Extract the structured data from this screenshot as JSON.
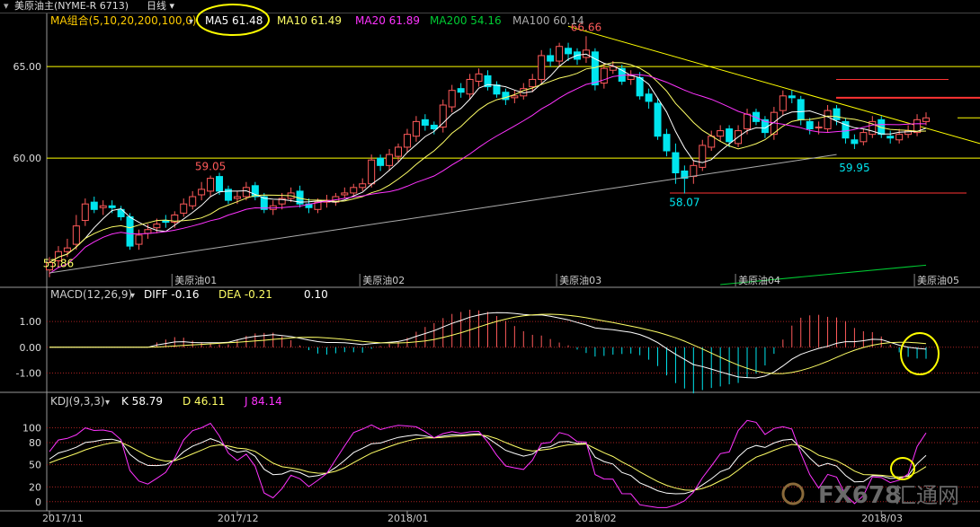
{
  "header": {
    "instrument": "美原油主(NYME-R 6713)",
    "period": "日线"
  },
  "colors": {
    "up": "#ff5a5a",
    "down": "#00e5ee",
    "ma5": "#ffffff",
    "ma10": "#ffff66",
    "ma20": "#ff33ff",
    "ma200": "#00cc33",
    "ma100": "#aaaaaa",
    "trend": "#ffff00",
    "hline_yellow": "#ffff00",
    "hline_red": "#ff3333",
    "grid": "#aa2222"
  },
  "chart_data": [
    {
      "type": "candlestick",
      "indicator_label": "MA组合(5,10,20,200,100,0)",
      "ma_legend": [
        {
          "name": "MA5",
          "value": "61.48"
        },
        {
          "name": "MA10",
          "value": "61.49"
        },
        {
          "name": "MA20",
          "value": "61.89"
        },
        {
          "name": "MA200",
          "value": "54.16"
        },
        {
          "name": "MA100",
          "value": "60.14"
        }
      ],
      "y_ticks": [
        "65.00",
        "60.00"
      ],
      "ylim": [
        53.0,
        67.9
      ],
      "annotations": [
        {
          "text": "66.66",
          "bar": 60,
          "value": 66.66
        },
        {
          "text": "59.05",
          "bar": 18,
          "value": 59.05
        },
        {
          "text": "58.07",
          "bar": 71,
          "value": 58.07
        },
        {
          "text": "59.95",
          "bar": 90,
          "value": 59.95
        },
        {
          "text": "53.86",
          "bar": 1,
          "value": 53.86
        }
      ],
      "contract_labels": [
        {
          "text": "美原油01",
          "bar": 14
        },
        {
          "text": "美原油02",
          "bar": 35
        },
        {
          "text": "美原油03",
          "bar": 57
        },
        {
          "text": "美原油04",
          "bar": 77
        },
        {
          "text": "美原油05",
          "bar": 97
        }
      ],
      "closes": [
        54.3,
        54.9,
        55.1,
        56.3,
        57.5,
        57.2,
        57.4,
        57.3,
        56.8,
        55.2,
        55.8,
        56.1,
        56.4,
        56.5,
        56.9,
        57.5,
        57.9,
        58.3,
        58.9,
        58.2,
        57.7,
        57.9,
        58.4,
        57.9,
        57.2,
        57.4,
        57.8,
        58.1,
        57.5,
        57.3,
        57.6,
        57.7,
        57.9,
        58.1,
        58.4,
        58.6,
        59.9,
        59.6,
        60.2,
        60.6,
        61.3,
        62.0,
        61.8,
        61.6,
        62.9,
        63.7,
        63.6,
        64.3,
        64.6,
        63.9,
        63.5,
        63.2,
        63.4,
        63.8,
        64.3,
        65.6,
        65.3,
        66.1,
        65.7,
        65.4,
        65.9,
        64.0,
        64.9,
        65.0,
        64.2,
        64.5,
        63.4,
        63.1,
        61.2,
        60.4,
        59.2,
        58.9,
        59.6,
        60.7,
        61.2,
        61.5,
        60.9,
        61.5,
        62.4,
        62.0,
        61.4,
        62.5,
        63.4,
        63.3,
        62.1,
        61.6,
        61.7,
        62.6,
        62.1,
        61.1,
        60.8,
        61.4,
        62.0,
        61.3,
        61.1,
        61.3,
        61.5,
        62.1,
        62.2
      ],
      "opens": [
        53.9,
        54.4,
        54.9,
        55.3,
        56.6,
        57.6,
        57.3,
        57.4,
        57.2,
        56.8,
        55.3,
        55.9,
        56.2,
        56.6,
        56.5,
        57.0,
        57.4,
        58.0,
        58.2,
        59.0,
        58.3,
        57.8,
        57.9,
        58.5,
        57.9,
        57.2,
        57.5,
        57.8,
        58.2,
        57.5,
        57.2,
        57.6,
        57.6,
        58.0,
        58.1,
        58.4,
        58.6,
        60.0,
        59.6,
        60.1,
        60.6,
        61.2,
        62.1,
        61.8,
        61.7,
        62.8,
        63.8,
        63.5,
        64.2,
        64.5,
        64.0,
        63.6,
        63.3,
        63.4,
        63.9,
        64.3,
        65.6,
        65.3,
        66.0,
        65.8,
        65.5,
        65.8,
        64.1,
        64.8,
        64.9,
        64.3,
        64.4,
        63.5,
        63.0,
        61.3,
        60.3,
        59.3,
        59.0,
        59.5,
        60.6,
        61.2,
        61.6,
        60.8,
        61.6,
        62.5,
        62.1,
        61.3,
        62.6,
        63.4,
        63.2,
        62.0,
        61.7,
        61.6,
        62.7,
        62.0,
        61.0,
        60.9,
        61.3,
        62.1,
        61.2,
        61.0,
        61.3,
        61.4,
        62.0
      ],
      "highs": [
        54.6,
        55.2,
        55.6,
        56.9,
        57.8,
        57.9,
        57.7,
        57.7,
        57.4,
        57.0,
        56.1,
        56.4,
        56.7,
        56.9,
        57.1,
        57.8,
        58.2,
        58.7,
        59.05,
        59.2,
        58.5,
        58.2,
        58.7,
        58.7,
        58.1,
        57.7,
        58.1,
        58.4,
        58.5,
        57.8,
        57.8,
        58.0,
        58.1,
        58.4,
        58.6,
        58.9,
        60.2,
        60.2,
        60.5,
        60.8,
        61.6,
        62.3,
        62.4,
        62.0,
        63.2,
        64.0,
        64.1,
        64.6,
        64.9,
        64.8,
        64.2,
        63.8,
        63.7,
        64.1,
        64.6,
        65.9,
        66.0,
        66.3,
        66.3,
        66.0,
        66.66,
        66.0,
        65.2,
        65.3,
        65.1,
        64.8,
        64.7,
        63.8,
        63.3,
        61.6,
        60.8,
        59.6,
        59.9,
        61.0,
        61.5,
        61.8,
        61.8,
        61.8,
        62.7,
        62.7,
        62.3,
        62.8,
        63.7,
        63.7,
        63.4,
        62.2,
        62.0,
        62.9,
        62.9,
        62.2,
        61.3,
        61.6,
        62.3,
        62.3,
        61.5,
        61.6,
        61.8,
        62.4,
        62.5
      ],
      "lows": [
        53.5,
        54.1,
        54.6,
        55.0,
        56.3,
        57.0,
        56.9,
        57.0,
        56.6,
        55.0,
        55.0,
        55.6,
        55.9,
        56.2,
        56.2,
        56.8,
        57.2,
        57.7,
        57.9,
        58.0,
        57.5,
        57.5,
        57.7,
        57.7,
        57.0,
        56.9,
        57.2,
        57.6,
        57.3,
        57.0,
        57.0,
        57.3,
        57.4,
        57.8,
        57.9,
        58.2,
        58.4,
        59.3,
        59.3,
        59.8,
        60.3,
        60.9,
        61.5,
        61.3,
        61.4,
        62.5,
        63.3,
        63.2,
        63.9,
        63.7,
        63.3,
        62.9,
        63.0,
        63.2,
        63.6,
        64.1,
        65.0,
        65.0,
        65.3,
        65.1,
        65.2,
        63.7,
        63.8,
        64.6,
        64.0,
        64.0,
        63.2,
        62.7,
        61.0,
        60.1,
        58.6,
        58.07,
        58.6,
        59.3,
        60.4,
        60.9,
        60.6,
        60.6,
        61.3,
        61.8,
        61.1,
        61.0,
        62.3,
        63.0,
        61.8,
        61.3,
        61.3,
        61.4,
        61.8,
        60.8,
        60.5,
        60.7,
        61.1,
        61.1,
        60.8,
        60.8,
        61.1,
        61.2,
        61.8
      ]
    },
    {
      "type": "line",
      "indicator_label": "MACD(12,26,9)",
      "legend": [
        {
          "name": "DIFF",
          "value": "-0.16"
        },
        {
          "name": "DEA",
          "value": "-0.21"
        },
        {
          "name": "",
          "value": "0.10"
        }
      ],
      "y_ticks": [
        "1.00",
        "0.00",
        "-1.00"
      ],
      "ylim": [
        -1.75,
        1.7
      ]
    },
    {
      "type": "line",
      "indicator_label": "KDJ(9,3,3)",
      "legend": [
        {
          "name": "K",
          "value": "58.79"
        },
        {
          "name": "D",
          "value": "46.11"
        },
        {
          "name": "J",
          "value": "84.14"
        }
      ],
      "y_ticks": [
        "100",
        "80",
        "50",
        "20",
        "0"
      ],
      "ylim": [
        -10,
        125
      ]
    },
    {
      "type": "axis",
      "x_ticks": [
        {
          "text": "2017/11",
          "bar": 0
        },
        {
          "text": "2017/12",
          "bar": 21
        },
        {
          "text": "2018/01",
          "bar": 40
        },
        {
          "text": "2018/02",
          "bar": 61
        },
        {
          "text": "2018/03",
          "bar": 93
        }
      ]
    }
  ],
  "watermark": {
    "brand": "FX678",
    "suffix": "汇通网"
  }
}
